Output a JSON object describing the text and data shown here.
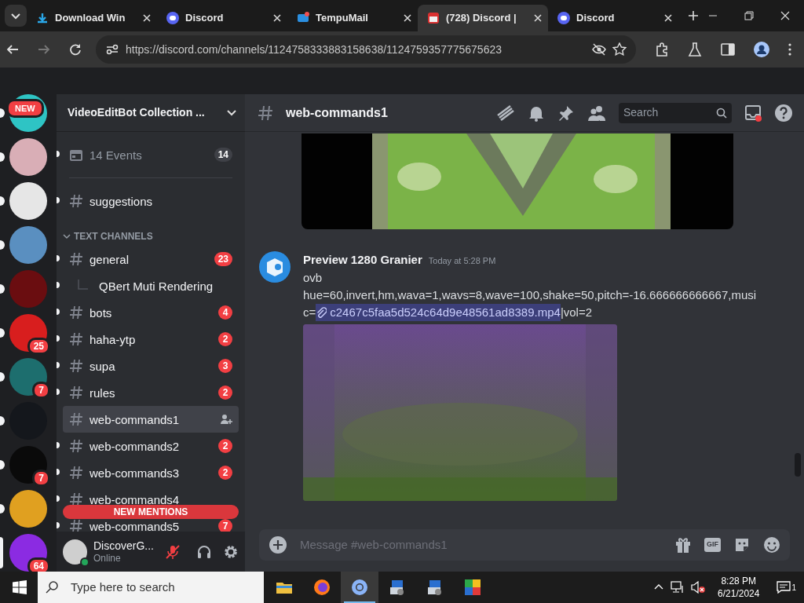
{
  "browser": {
    "tabs": [
      {
        "label": "Download Win",
        "kind": "download",
        "selected": false
      },
      {
        "label": "Discord",
        "kind": "discord",
        "selected": false
      },
      {
        "label": "TempuMail",
        "kind": "mail",
        "selected": false
      },
      {
        "label": "(728) Discord |",
        "kind": "calendar",
        "selected": true
      },
      {
        "label": "Discord",
        "kind": "discord",
        "selected": false
      }
    ],
    "url": "https://discord.com/channels/1124758333883158638/1124759357775675623",
    "forward_disabled": true
  },
  "servers": [
    {
      "color": "#2ec4c4",
      "badge": "NEW",
      "unread": true,
      "selected": false
    },
    {
      "color": "#d9aeb6",
      "unread": true,
      "selected": false
    },
    {
      "color": "#e6e6e6",
      "unread": true,
      "selected": false
    },
    {
      "color": "#5a8fc0",
      "unread": true,
      "selected": false
    },
    {
      "color": "#6a0d10",
      "unread": true,
      "selected": false
    },
    {
      "color": "#d81e1e",
      "badge": "25",
      "unread": true,
      "selected": false
    },
    {
      "color": "#1d6e6e",
      "badge": "7",
      "unread": true,
      "selected": false
    },
    {
      "color": "#14171c",
      "unread": true,
      "selected": false
    },
    {
      "color": "#0a0a0a",
      "badge": "7",
      "unread": true,
      "selected": false
    },
    {
      "color": "#e0a020",
      "unread": true,
      "selected": false
    },
    {
      "color": "#8b2be2",
      "badge": "64",
      "unread": false,
      "selected": true
    }
  ],
  "server_name": "VideoEditBot Collection ...",
  "top_items": [
    {
      "kind": "events",
      "name": "14 Events",
      "badge": "14",
      "unread": true,
      "selected": false
    },
    {
      "kind": "channel",
      "name": "suggestions",
      "unread": true,
      "selected": false
    }
  ],
  "category": {
    "name": "TEXT CHANNELS",
    "expanded": true,
    "channels": [
      {
        "kind": "channel",
        "name": "general",
        "badge": "23",
        "unread": true,
        "selected": false
      },
      {
        "kind": "thread",
        "name": "QBert Muti Rendering",
        "unread": true,
        "selected": false
      },
      {
        "kind": "channel",
        "name": "bots",
        "badge": "4",
        "unread": true,
        "selected": false
      },
      {
        "kind": "channel",
        "name": "haha-ytp",
        "badge": "2",
        "unread": true,
        "selected": false
      },
      {
        "kind": "channel",
        "name": "supa",
        "badge": "3",
        "unread": true,
        "selected": false
      },
      {
        "kind": "channel",
        "name": "rules",
        "badge": "2",
        "unread": true,
        "selected": false
      },
      {
        "kind": "channel",
        "name": "web-commands1",
        "unread": false,
        "selected": true
      },
      {
        "kind": "channel",
        "name": "web-commands2",
        "badge": "2",
        "unread": true,
        "selected": false
      },
      {
        "kind": "channel",
        "name": "web-commands3",
        "badge": "2",
        "unread": true,
        "selected": false
      },
      {
        "kind": "channel",
        "name": "web-commands4",
        "unread": true,
        "selected": false
      },
      {
        "kind": "channel",
        "name": "web-commands5",
        "badge": "7",
        "unread": true,
        "selected": false
      }
    ]
  },
  "new_mentions": "NEW MENTIONS",
  "user": {
    "name": "DiscoverG...",
    "status": "Online",
    "muted": true
  },
  "channel_header": {
    "name": "web-commands1",
    "search_placeholder": "Search"
  },
  "message": {
    "author": "Preview 1280 Granier",
    "timestamp": "Today at 5:28 PM",
    "lines": [
      "ovb",
      "hue=60,invert,hm,wava=1,wavs=8,wave=100,shake=50,pitch=-16.666666666667,musi"
    ],
    "link_line": {
      "before": "c=",
      "attachment": "c2467c5faa5d524c64d9e48561ad8389.mp4",
      "after": "|vol=2"
    }
  },
  "composer": {
    "placeholder": "Message #web-commands1",
    "gif_label": "GIF"
  },
  "taskbar": {
    "search_placeholder": "Type here to search",
    "apps": [
      {
        "kind": "folder",
        "active": false
      },
      {
        "kind": "firefox",
        "active": false
      },
      {
        "kind": "chrome",
        "active": true
      },
      {
        "kind": "installer",
        "active": false
      },
      {
        "kind": "installer",
        "active": false
      },
      {
        "kind": "tiles",
        "active": false
      }
    ],
    "time": "8:28 PM",
    "date": "6/21/2024",
    "notifications": "1",
    "volume_muted": true
  }
}
